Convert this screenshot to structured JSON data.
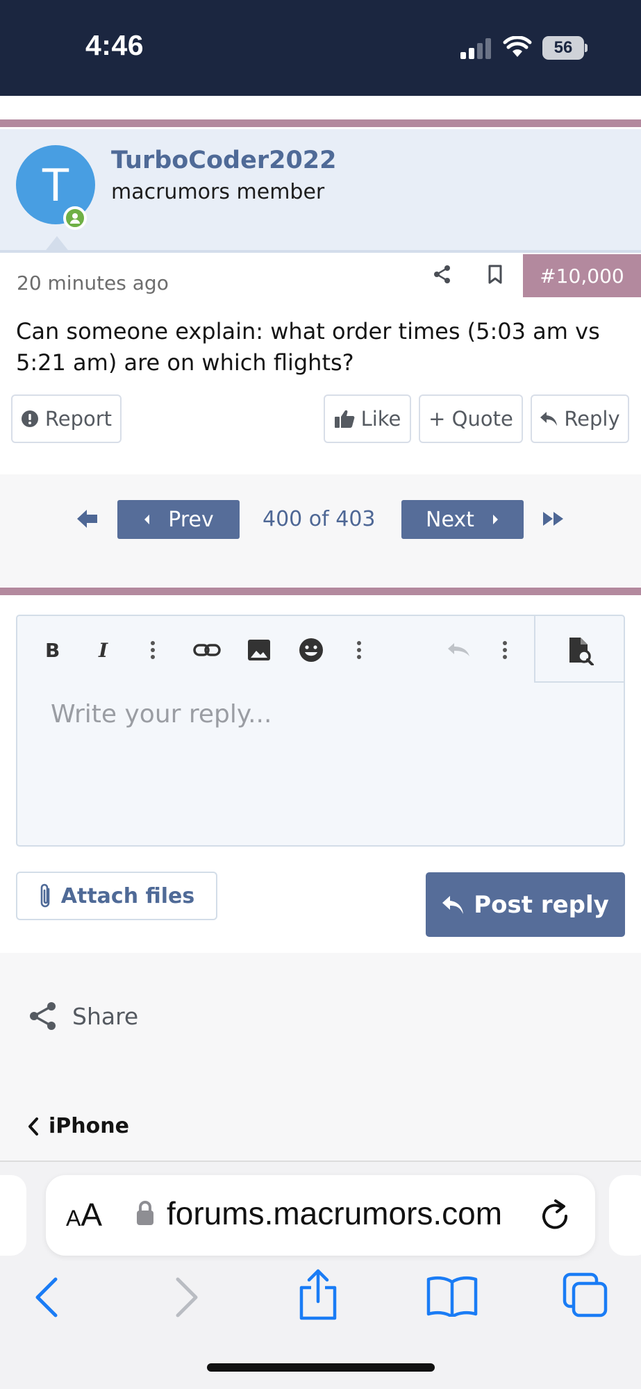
{
  "status_bar": {
    "time": "4:46",
    "battery": "56"
  },
  "post": {
    "avatar_letter": "T",
    "username": "TurboCoder2022",
    "user_title": "macrumors member",
    "time_ago": "20 minutes ago",
    "post_number": "#10,000",
    "body": "Can someone explain: what order times (5:03 am vs 5:21 am) are on which flights?",
    "buttons": {
      "report": "Report",
      "like": "Like",
      "quote": "+ Quote",
      "reply": "Reply"
    }
  },
  "pagination": {
    "prev": "Prev",
    "next": "Next",
    "page_text": "400 of 403"
  },
  "editor": {
    "placeholder": "Write your reply...",
    "toolbar_icons": [
      "bold-icon",
      "italic-icon",
      "more-vertical-icon",
      "link-icon",
      "image-icon",
      "emoji-icon",
      "more-vertical-icon",
      "undo-icon",
      "more-vertical-icon",
      "preview-icon"
    ],
    "attach_label": "Attach files",
    "post_label": "Post reply"
  },
  "share": {
    "label": "Share"
  },
  "breadcrumb": {
    "label": "iPhone"
  },
  "safari": {
    "aa_small": "A",
    "aa_large": "A",
    "url": "forums.macrumors.com"
  },
  "colors": {
    "accent": "#b3899e",
    "primary_button": "#566d99",
    "link": "#4f6a97",
    "status_bar": "#1b2640",
    "ios_blue": "#1a7cf5"
  }
}
